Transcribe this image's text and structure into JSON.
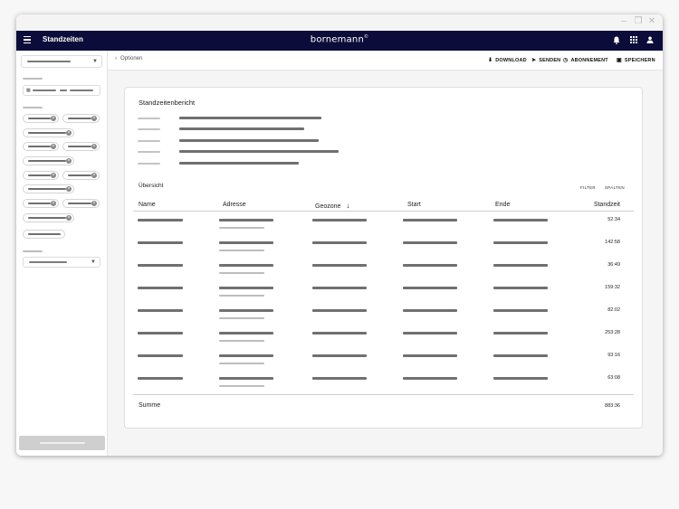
{
  "window": {
    "controls": [
      "–",
      "❐",
      "✕"
    ]
  },
  "appbar": {
    "title": "Standzeiten",
    "brand": "bornemann",
    "brand_mark": "©",
    "icons": [
      "bell-icon",
      "grid-icon",
      "user-icon"
    ]
  },
  "toolbar": {
    "back_label": "Optionen",
    "download": "DOWNLOAD",
    "senden": "SENDEN",
    "abonnement": "ABONNEMENT",
    "speichern": "SPEICHERN"
  },
  "report": {
    "title": "Standzeitenbericht",
    "overview": "Übersicht",
    "filter": "FILTER",
    "spalten": "SPALTEN",
    "columns": [
      "Name",
      "Adresse",
      "Geozone",
      "Start",
      "Ende",
      "Standzeit"
    ],
    "sort_indicator": "↓",
    "rows": [
      {
        "standzeit": "52:34"
      },
      {
        "standzeit": "142:58"
      },
      {
        "standzeit": "36:49"
      },
      {
        "standzeit": "159:32"
      },
      {
        "standzeit": "82:02"
      },
      {
        "standzeit": "253:28"
      },
      {
        "standzeit": "93:16"
      },
      {
        "standzeit": "63:08"
      }
    ],
    "sum_label": "Summe",
    "sum_value": "883:36"
  },
  "colors": {
    "appbar": "#0c0c3a",
    "placeholder_dark": "#707070",
    "placeholder_light": "#bdbdbd"
  }
}
